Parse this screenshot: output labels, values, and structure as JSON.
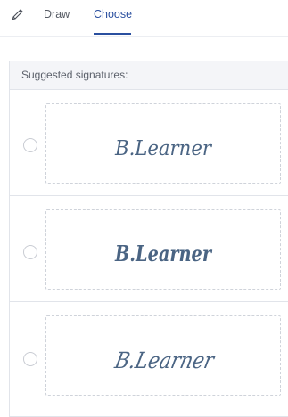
{
  "tabs": {
    "draw_label": "Draw",
    "choose_label": "Choose",
    "active": "Choose",
    "accent_color": "#2a4f9f"
  },
  "panel": {
    "header": "Suggested signatures:"
  },
  "signatures": [
    {
      "text": "B.Learner",
      "style": "thin-script",
      "selected": false
    },
    {
      "text": "B.Learner",
      "style": "bold-script",
      "selected": false
    },
    {
      "text": "B.Learner",
      "style": "slanted-script",
      "selected": false
    }
  ],
  "icons": {
    "draw_tab_icon": "pen-icon"
  }
}
